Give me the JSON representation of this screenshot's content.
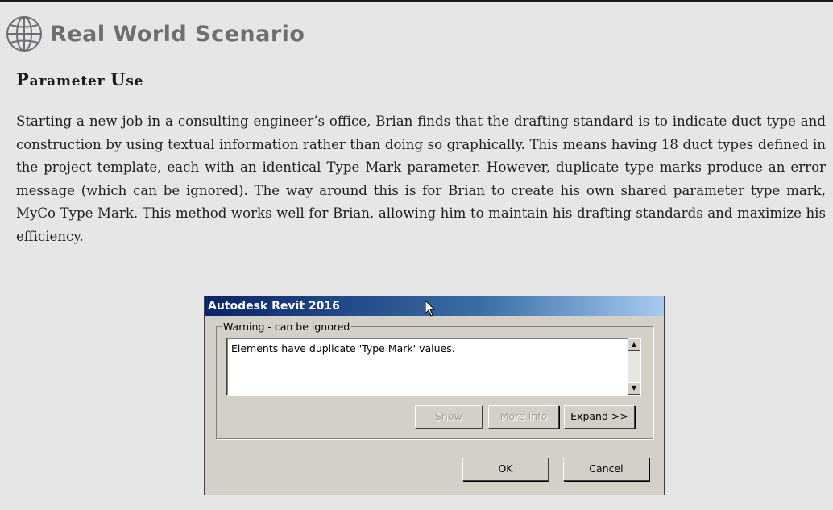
{
  "sidebar": {
    "title": "Real World Scenario",
    "icon": "globe-icon"
  },
  "section": {
    "heading_cap1": "P",
    "heading_rest1": "arameter ",
    "heading_cap2": "U",
    "heading_rest2": "se"
  },
  "paragraph": "Starting a new job in a consulting engineer’s office, Brian finds that the drafting standard is to indicate duct type and construction by using textual information rather than doing so graphically. This means having 18 duct types defined in the project template, each with an identical Type Mark parameter. However, duplicate type marks produce an error message (which can be ignored). The way around this is for Brian to create his own shared parameter type mark, MyCo Type Mark. This method works well for Brian, allowing him to maintain his drafting standards and maximize his efficiency.",
  "dialog": {
    "title": "Autodesk Revit 2016",
    "group_label": "Warning - can be ignored",
    "message": "Elements have duplicate 'Type Mark' values.",
    "show_label": "Show",
    "more_info_label": "More Info",
    "expand_label": "Expand >>",
    "ok_label": "OK",
    "cancel_label": "Cancel"
  }
}
